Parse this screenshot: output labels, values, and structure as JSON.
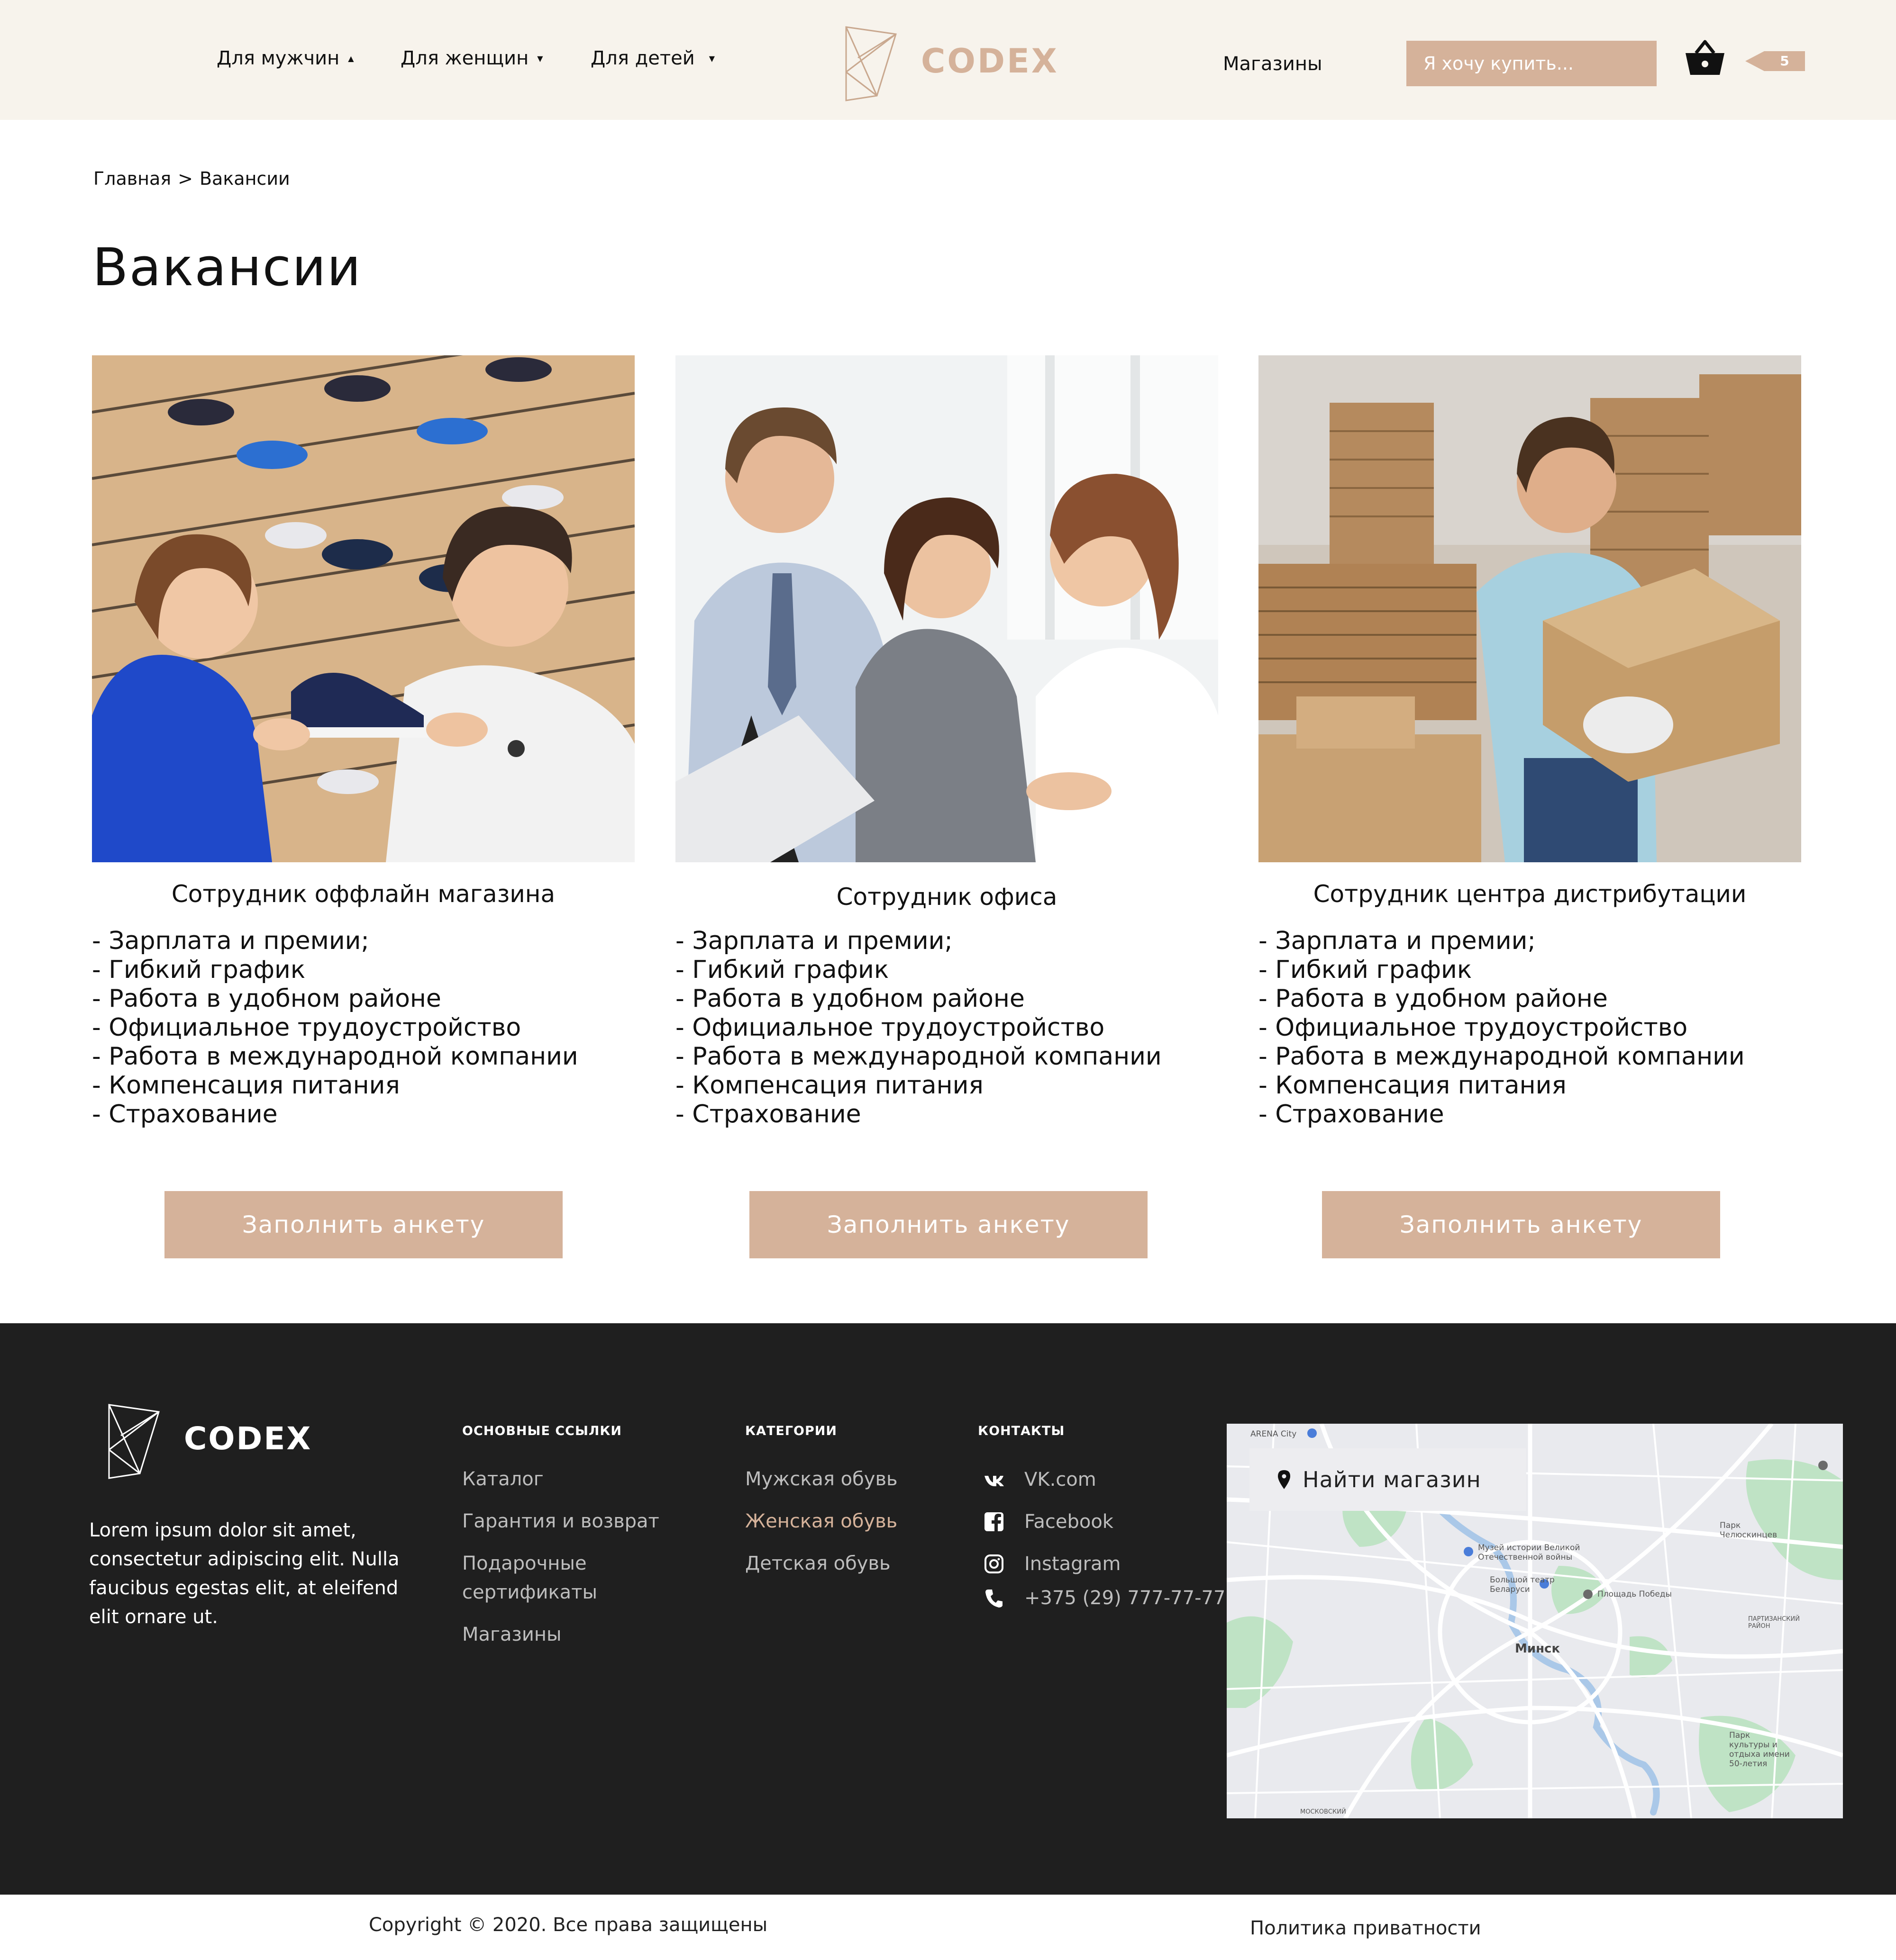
{
  "header": {
    "nav": [
      {
        "label": "Для мужчин",
        "arrow": "▲"
      },
      {
        "label": "Для женщин",
        "arrow": "▼"
      },
      {
        "label": "Для детей",
        "arrow": "▼"
      }
    ],
    "logo_text": "CODEX",
    "stores_label": "Магазины",
    "search_placeholder": "Я хочу купить...",
    "cart_count": "5"
  },
  "breadcrumb": {
    "home": "Главная",
    "separator": ">",
    "current": "Вакансии"
  },
  "page_title": "Вакансии",
  "vacancies": [
    {
      "title": "Сотрудник оффлайн магазина",
      "benefits": [
        "- Зарплата и премии;",
        "- Гибкий график",
        "- Работа в удобном районе",
        "- Официальное трудоустройство",
        "- Работа в международной компании",
        "- Компенсация питания",
        "- Страхование"
      ],
      "button_label": "Заполнить анкету"
    },
    {
      "title": "Сотрудник офиса",
      "benefits": [
        "- Зарплата и премии;",
        "- Гибкий график",
        "- Работа в удобном районе",
        "- Официальное трудоустройство",
        "- Работа в международной компании",
        "- Компенсация питания",
        "- Страхование"
      ],
      "button_label": "Заполнить анкету"
    },
    {
      "title": "Сотрудник центра дистрибутации",
      "benefits": [
        "- Зарплата и премии;",
        "- Гибкий график",
        "- Работа в удобном районе",
        "- Официальное трудоустройство",
        "- Работа в международной компании",
        "- Компенсация питания",
        "- Страхование"
      ],
      "button_label": "Заполнить анкету"
    }
  ],
  "footer": {
    "logo_text": "CODEX",
    "about": "Lorem ipsum dolor sit amet, consectetur adipiscing elit. Nulla faucibus egestas elit, at eleifend elit ornare ut.",
    "links_heading": "ОСНОВНЫЕ ССЫЛКИ",
    "links": [
      "Каталог",
      "Гарантия и возврат",
      "Подарочные сертификаты",
      "Магазины"
    ],
    "categories_heading": "КАТЕГОРИИ",
    "categories": [
      "Мужская обувь",
      "Женская обувь",
      "Детская обувь"
    ],
    "contacts_heading": "КОНТАКТЫ",
    "contacts": [
      {
        "icon": "vk-icon",
        "label": "VK.com"
      },
      {
        "icon": "facebook-icon",
        "label": "Facebook"
      },
      {
        "icon": "instagram-icon",
        "label": "Instagram"
      },
      {
        "icon": "phone-icon",
        "label": "+375 (29) 777-77-77"
      }
    ],
    "map": {
      "button_label": "Найти магазин",
      "labels": {
        "arena": "ARENA City",
        "museum": "Музей истории Великой Отечественной войны",
        "theatre": "Большой театр Беларуси",
        "square": "Площадь Победы",
        "city": "Минск",
        "park1": "Парк Челюскинцев",
        "district": "ПАРТИЗАНСКИЙ РАЙОН",
        "park2": "Парк культуры и отдыха имени 50-летия",
        "moscow": "МОСКОВСКИЙ"
      }
    }
  },
  "bottom_bar": {
    "copyright": "Copyright © 2020. Все права защищены",
    "privacy": "Политика приватности"
  },
  "colors": {
    "accent": "#d5b29a",
    "header_bg": "#f7f3ec",
    "footer_bg": "#1f1f1f"
  }
}
